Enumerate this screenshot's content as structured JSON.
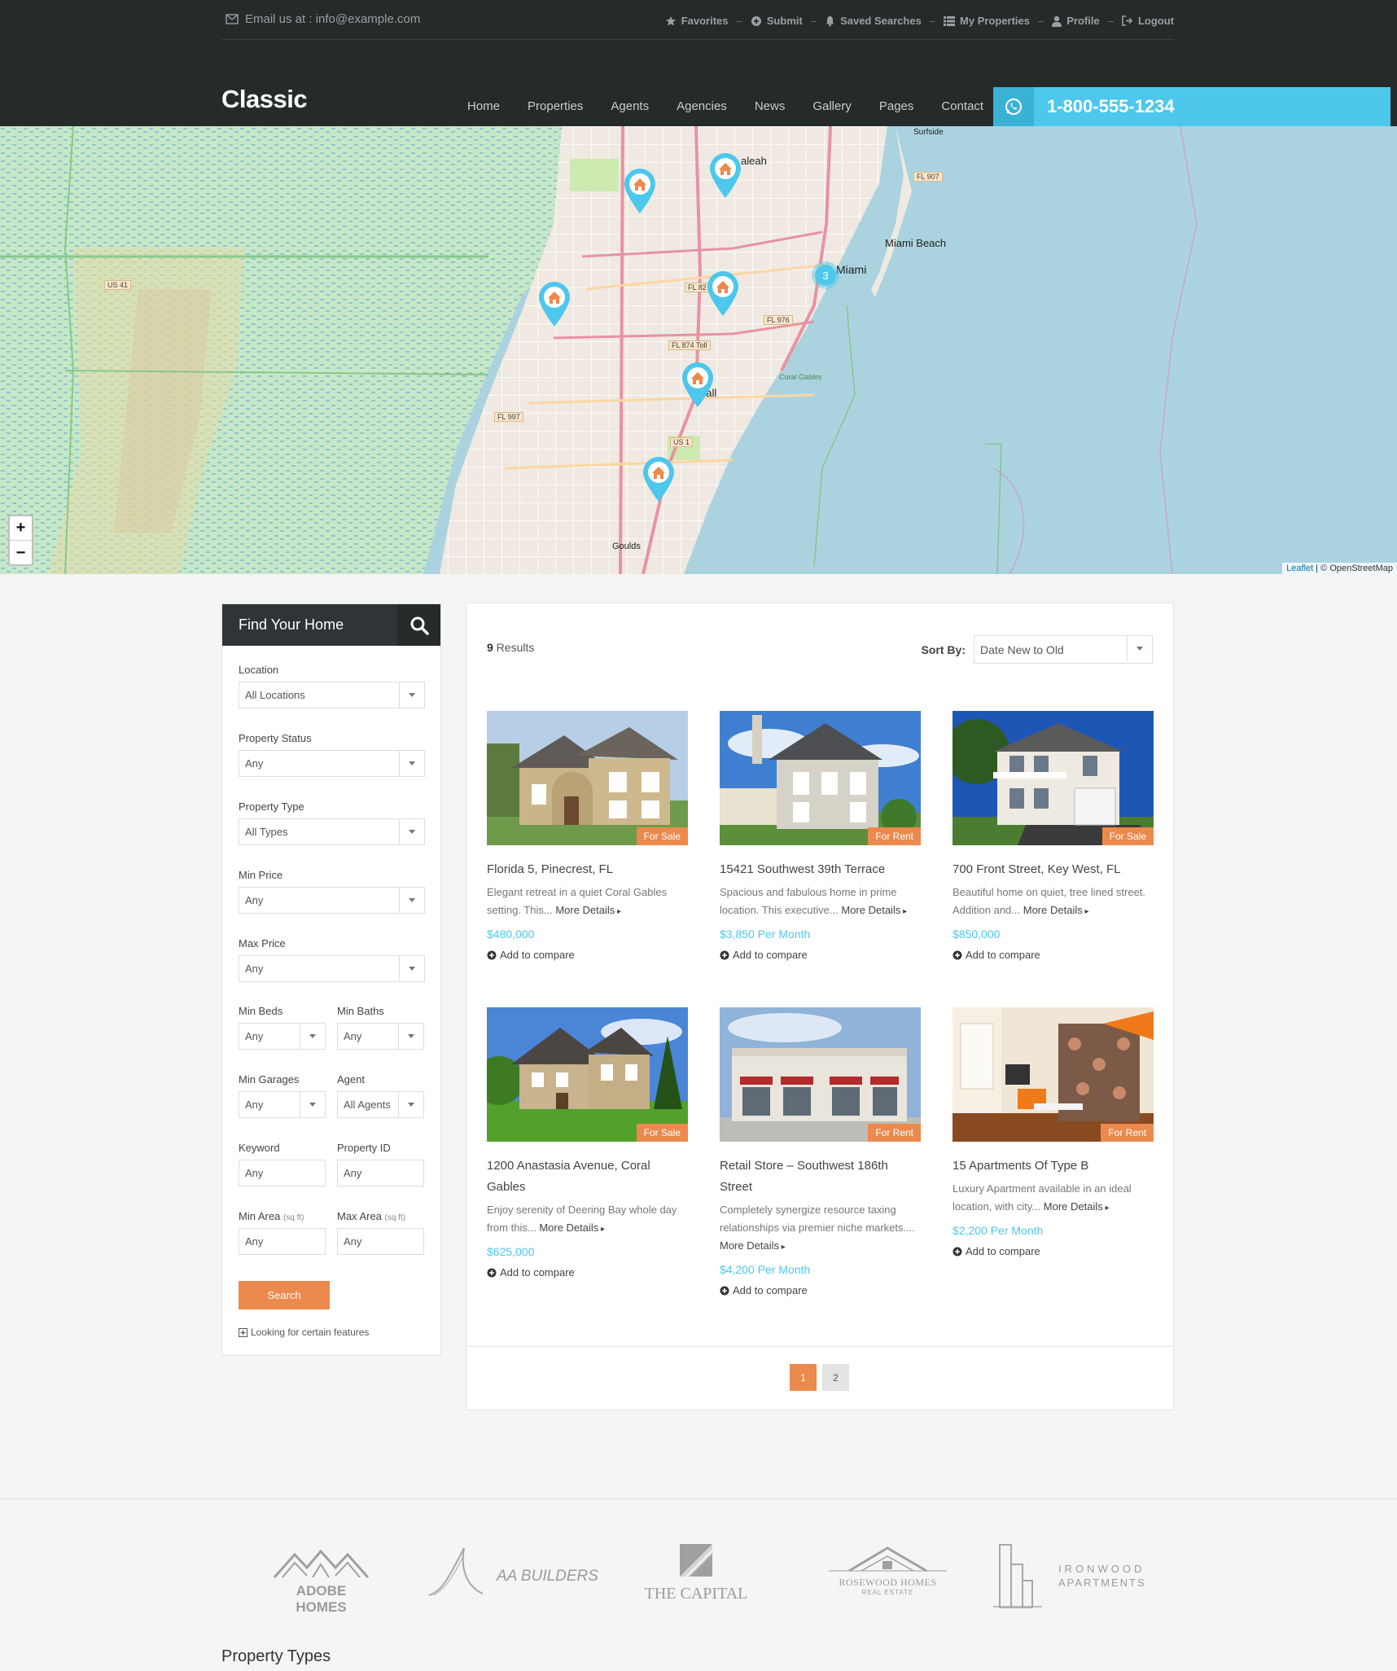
{
  "topbar": {
    "email": "Email us at : info@example.com",
    "links": [
      {
        "label": "Favorites",
        "icon": "star-icon"
      },
      {
        "label": "Submit",
        "icon": "plus-circle-icon"
      },
      {
        "label": "Saved Searches",
        "icon": "bell-icon"
      },
      {
        "label": "My Properties",
        "icon": "list-icon"
      },
      {
        "label": "Profile",
        "icon": "user-icon"
      },
      {
        "label": "Logout",
        "icon": "logout-icon"
      }
    ],
    "separator": "–"
  },
  "logo": "Classic",
  "nav": [
    "Home",
    "Properties",
    "Agents",
    "Agencies",
    "News",
    "Gallery",
    "Pages",
    "Contact"
  ],
  "phone": "1-800-555-1234",
  "map": {
    "labels": {
      "miami_beach": "Miami Beach",
      "miami": "Miami",
      "hialeah": "aleah",
      "kendall": "dall",
      "goulds": "Goulds",
      "surfside": "Surfside",
      "coral_gables": "Coral Gables"
    },
    "road_signs": [
      "US 41",
      "FL 907",
      "FL 82",
      "FL 976",
      "FL 874 Toll",
      "FL 997",
      "US 1"
    ],
    "cluster_count": "3",
    "zoom_in": "+",
    "zoom_out": "−",
    "attribution_leaflet": "Leaflet",
    "attribution_osm": " | © OpenStreetMap"
  },
  "search": {
    "title": "Find Your Home",
    "fields": {
      "location": {
        "label": "Location",
        "value": "All Locations"
      },
      "status": {
        "label": "Property Status",
        "value": "Any"
      },
      "type": {
        "label": "Property Type",
        "value": "All Types"
      },
      "min_price": {
        "label": "Min Price",
        "value": "Any"
      },
      "max_price": {
        "label": "Max Price",
        "value": "Any"
      },
      "min_beds": {
        "label": "Min Beds",
        "value": "Any"
      },
      "min_baths": {
        "label": "Min Baths",
        "value": "Any"
      },
      "min_garages": {
        "label": "Min Garages",
        "value": "Any"
      },
      "agent": {
        "label": "Agent",
        "value": "All Agents"
      },
      "keyword": {
        "label": "Keyword",
        "placeholder": "Any"
      },
      "property_id": {
        "label": "Property ID",
        "placeholder": "Any"
      },
      "min_area": {
        "label": "Min Area",
        "unit": "(sq ft)",
        "placeholder": "Any"
      },
      "max_area": {
        "label": "Max Area",
        "unit": "(sq ft)",
        "placeholder": "Any"
      }
    },
    "button": "Search",
    "features_link": "Looking for certain features"
  },
  "results": {
    "count": "9",
    "count_label": " Results",
    "sort_label": "Sort By:",
    "sort_value": "Date New to Old",
    "more_label": "More Details",
    "compare_label": "Add to compare",
    "cards": [
      {
        "title": "Florida 5, Pinecrest, FL",
        "desc": "Elegant retreat in a quiet Coral Gables setting. This...",
        "price": "$480,000",
        "badge": "For Sale"
      },
      {
        "title": "15421 Southwest 39th Terrace",
        "desc": "Spacious and fabulous home in prime location. This executive...",
        "price": "$3,850 Per Month",
        "badge": "For Rent"
      },
      {
        "title": "700 Front Street, Key West, FL",
        "desc": "Beautiful home on quiet, tree lined street. Addition and...",
        "price": "$850,000",
        "badge": "For Sale"
      },
      {
        "title": "1200 Anastasia Avenue, Coral Gables",
        "desc": "Enjoy serenity of Deering Bay whole day from this...",
        "price": "$625,000",
        "badge": "For Sale"
      },
      {
        "title": "Retail Store – Southwest 186th Street",
        "desc": "Completely synergize resource taxing relationships via premier niche markets....",
        "price": "$4,200 Per Month",
        "badge": "For Rent"
      },
      {
        "title": "15 Apartments Of Type B",
        "desc": "Luxury Apartment available in an ideal location, with city...",
        "price": "$2,200 Per Month",
        "badge": "For Rent"
      }
    ],
    "pages": [
      "1",
      "2"
    ]
  },
  "partners": {
    "logos": [
      {
        "line1": "ADOBE HOMES"
      },
      {
        "line1": "AA BUILDERS"
      },
      {
        "line1": "THE CAPITAL"
      },
      {
        "line1": "ROSEWOOD HOMES",
        "line2": "REAL ESTATE"
      },
      {
        "line1": "IRONWOOD",
        "line2": "APARTMENTS"
      }
    ],
    "section_title": "Property Types"
  },
  "colors": {
    "accent_orange": "#ec894d",
    "accent_blue": "#4dc7ec",
    "header_dark": "#252a2b"
  }
}
